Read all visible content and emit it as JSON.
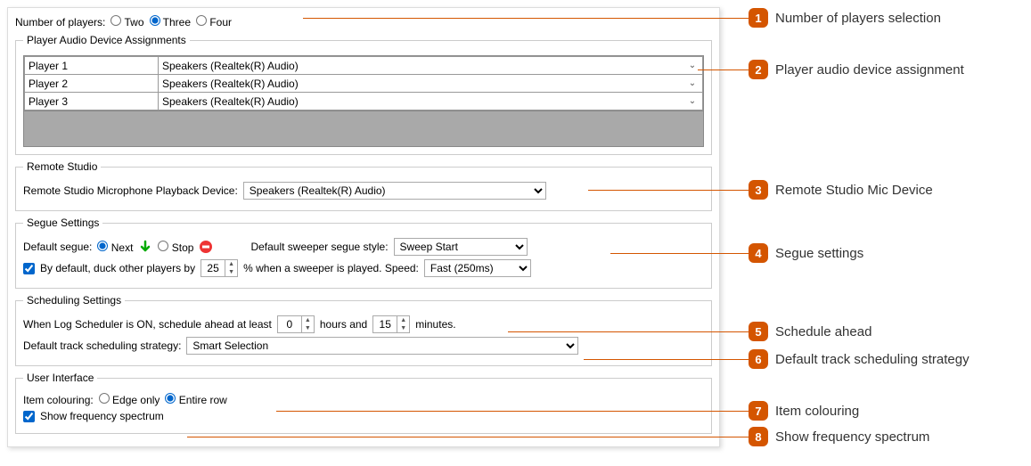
{
  "players": {
    "label": "Number of players:",
    "options": {
      "two": "Two",
      "three": "Three",
      "four": "Four"
    },
    "selected": "three"
  },
  "assignments": {
    "legend": "Player Audio Device Assignments",
    "rows": [
      {
        "name": "Player 1",
        "device": "Speakers (Realtek(R) Audio)"
      },
      {
        "name": "Player 2",
        "device": "Speakers (Realtek(R) Audio)"
      },
      {
        "name": "Player 3",
        "device": "Speakers (Realtek(R) Audio)"
      }
    ]
  },
  "remote": {
    "legend": "Remote Studio",
    "label": "Remote Studio Microphone Playback Device:",
    "device": "Speakers (Realtek(R) Audio)"
  },
  "segue": {
    "legend": "Segue Settings",
    "default_label": "Default segue:",
    "opt_next": "Next",
    "opt_stop": "Stop",
    "sweeper_style_label": "Default sweeper segue style:",
    "sweeper_style_value": "Sweep Start",
    "duck_label_pre": "By default, duck other players by",
    "duck_value": "25",
    "duck_label_post": "% when a sweeper is played.  Speed:",
    "speed_value": "Fast (250ms)"
  },
  "schedule": {
    "legend": "Scheduling Settings",
    "ahead_pre": "When Log Scheduler is ON, schedule ahead at least",
    "hours": "0",
    "hours_unit": "hours and",
    "minutes": "15",
    "minutes_unit": "minutes.",
    "strategy_label": "Default track scheduling strategy:",
    "strategy_value": "Smart Selection"
  },
  "ui": {
    "legend": "User Interface",
    "colouring_label": "Item colouring:",
    "opt_edge": "Edge only",
    "opt_row": "Entire row",
    "show_spectrum": "Show frequency spectrum"
  },
  "callouts": {
    "c1": "Number of players selection",
    "c2": "Player audio device assignment",
    "c3": "Remote Studio Mic Device",
    "c4": "Segue settings",
    "c5": "Schedule ahead",
    "c6": "Default track scheduling strategy",
    "c7": "Item colouring",
    "c8": "Show frequency spectrum"
  }
}
